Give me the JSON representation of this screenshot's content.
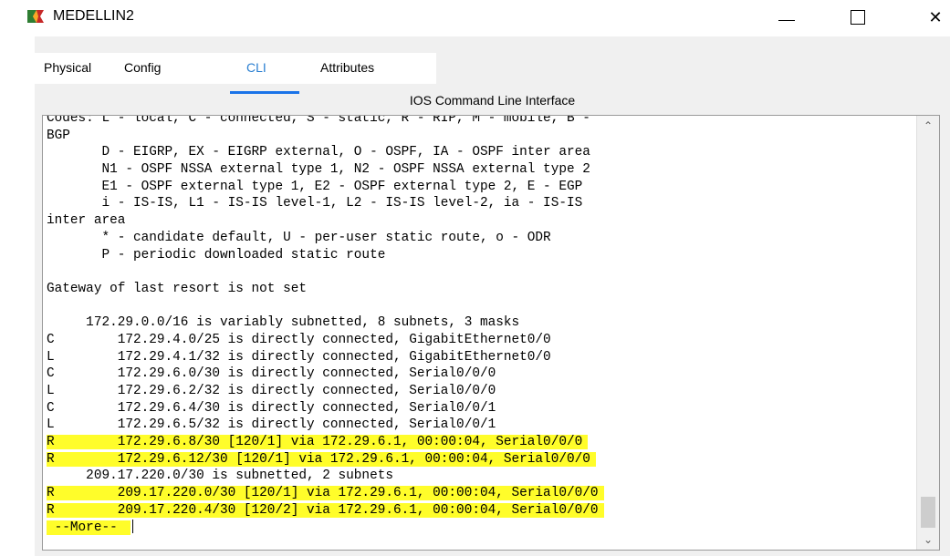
{
  "window": {
    "title": "MEDELLIN2",
    "icons": {
      "app": "router-icon",
      "minimize": "minimize-icon",
      "maximize": "maximize-icon",
      "close": "close-icon"
    },
    "close_glyph": "✕"
  },
  "tabs": [
    {
      "label": "Physical",
      "active": false
    },
    {
      "label": "Config",
      "active": false
    },
    {
      "label": "CLI",
      "active": true
    },
    {
      "label": "Attributes",
      "active": false
    }
  ],
  "cli": {
    "header": "IOS Command Line Interface",
    "highlight_color": "#fffd2a",
    "lines": [
      {
        "text": "Codes: L - local, C - connected, S - static, R - RIP, M - mobile, B -",
        "highlight": false
      },
      {
        "text": "BGP",
        "highlight": false
      },
      {
        "text": "       D - EIGRP, EX - EIGRP external, O - OSPF, IA - OSPF inter area",
        "highlight": false
      },
      {
        "text": "       N1 - OSPF NSSA external type 1, N2 - OSPF NSSA external type 2",
        "highlight": false
      },
      {
        "text": "       E1 - OSPF external type 1, E2 - OSPF external type 2, E - EGP",
        "highlight": false
      },
      {
        "text": "       i - IS-IS, L1 - IS-IS level-1, L2 - IS-IS level-2, ia - IS-IS",
        "highlight": false
      },
      {
        "text": "inter area",
        "highlight": false
      },
      {
        "text": "       * - candidate default, U - per-user static route, o - ODR",
        "highlight": false
      },
      {
        "text": "       P - periodic downloaded static route",
        "highlight": false
      },
      {
        "text": "",
        "highlight": false
      },
      {
        "text": "Gateway of last resort is not set",
        "highlight": false
      },
      {
        "text": "",
        "highlight": false
      },
      {
        "text": "     172.29.0.0/16 is variably subnetted, 8 subnets, 3 masks",
        "highlight": false
      },
      {
        "text": "C        172.29.4.0/25 is directly connected, GigabitEthernet0/0",
        "highlight": false
      },
      {
        "text": "L        172.29.4.1/32 is directly connected, GigabitEthernet0/0",
        "highlight": false
      },
      {
        "text": "C        172.29.6.0/30 is directly connected, Serial0/0/0",
        "highlight": false
      },
      {
        "text": "L        172.29.6.2/32 is directly connected, Serial0/0/0",
        "highlight": false
      },
      {
        "text": "C        172.29.6.4/30 is directly connected, Serial0/0/1",
        "highlight": false
      },
      {
        "text": "L        172.29.6.5/32 is directly connected, Serial0/0/1",
        "highlight": false
      },
      {
        "text": "R        172.29.6.8/30 [120/1] via 172.29.6.1, 00:00:04, Serial0/0/0",
        "highlight": true
      },
      {
        "text": "R        172.29.6.12/30 [120/1] via 172.29.6.1, 00:00:04, Serial0/0/0",
        "highlight": true
      },
      {
        "text": "     209.17.220.0/30 is subnetted, 2 subnets",
        "highlight": false
      },
      {
        "text": "R        209.17.220.0/30 [120/1] via 172.29.6.1, 00:00:04, Serial0/0/0",
        "highlight": true
      },
      {
        "text": "R        209.17.220.4/30 [120/2] via 172.29.6.1, 00:00:04, Serial0/0/0",
        "highlight": true
      },
      {
        "text": " --More-- ",
        "highlight": true,
        "cursor": true
      }
    ]
  },
  "scrollbar": {
    "up_glyph": "⌃",
    "down_glyph": "⌄"
  }
}
